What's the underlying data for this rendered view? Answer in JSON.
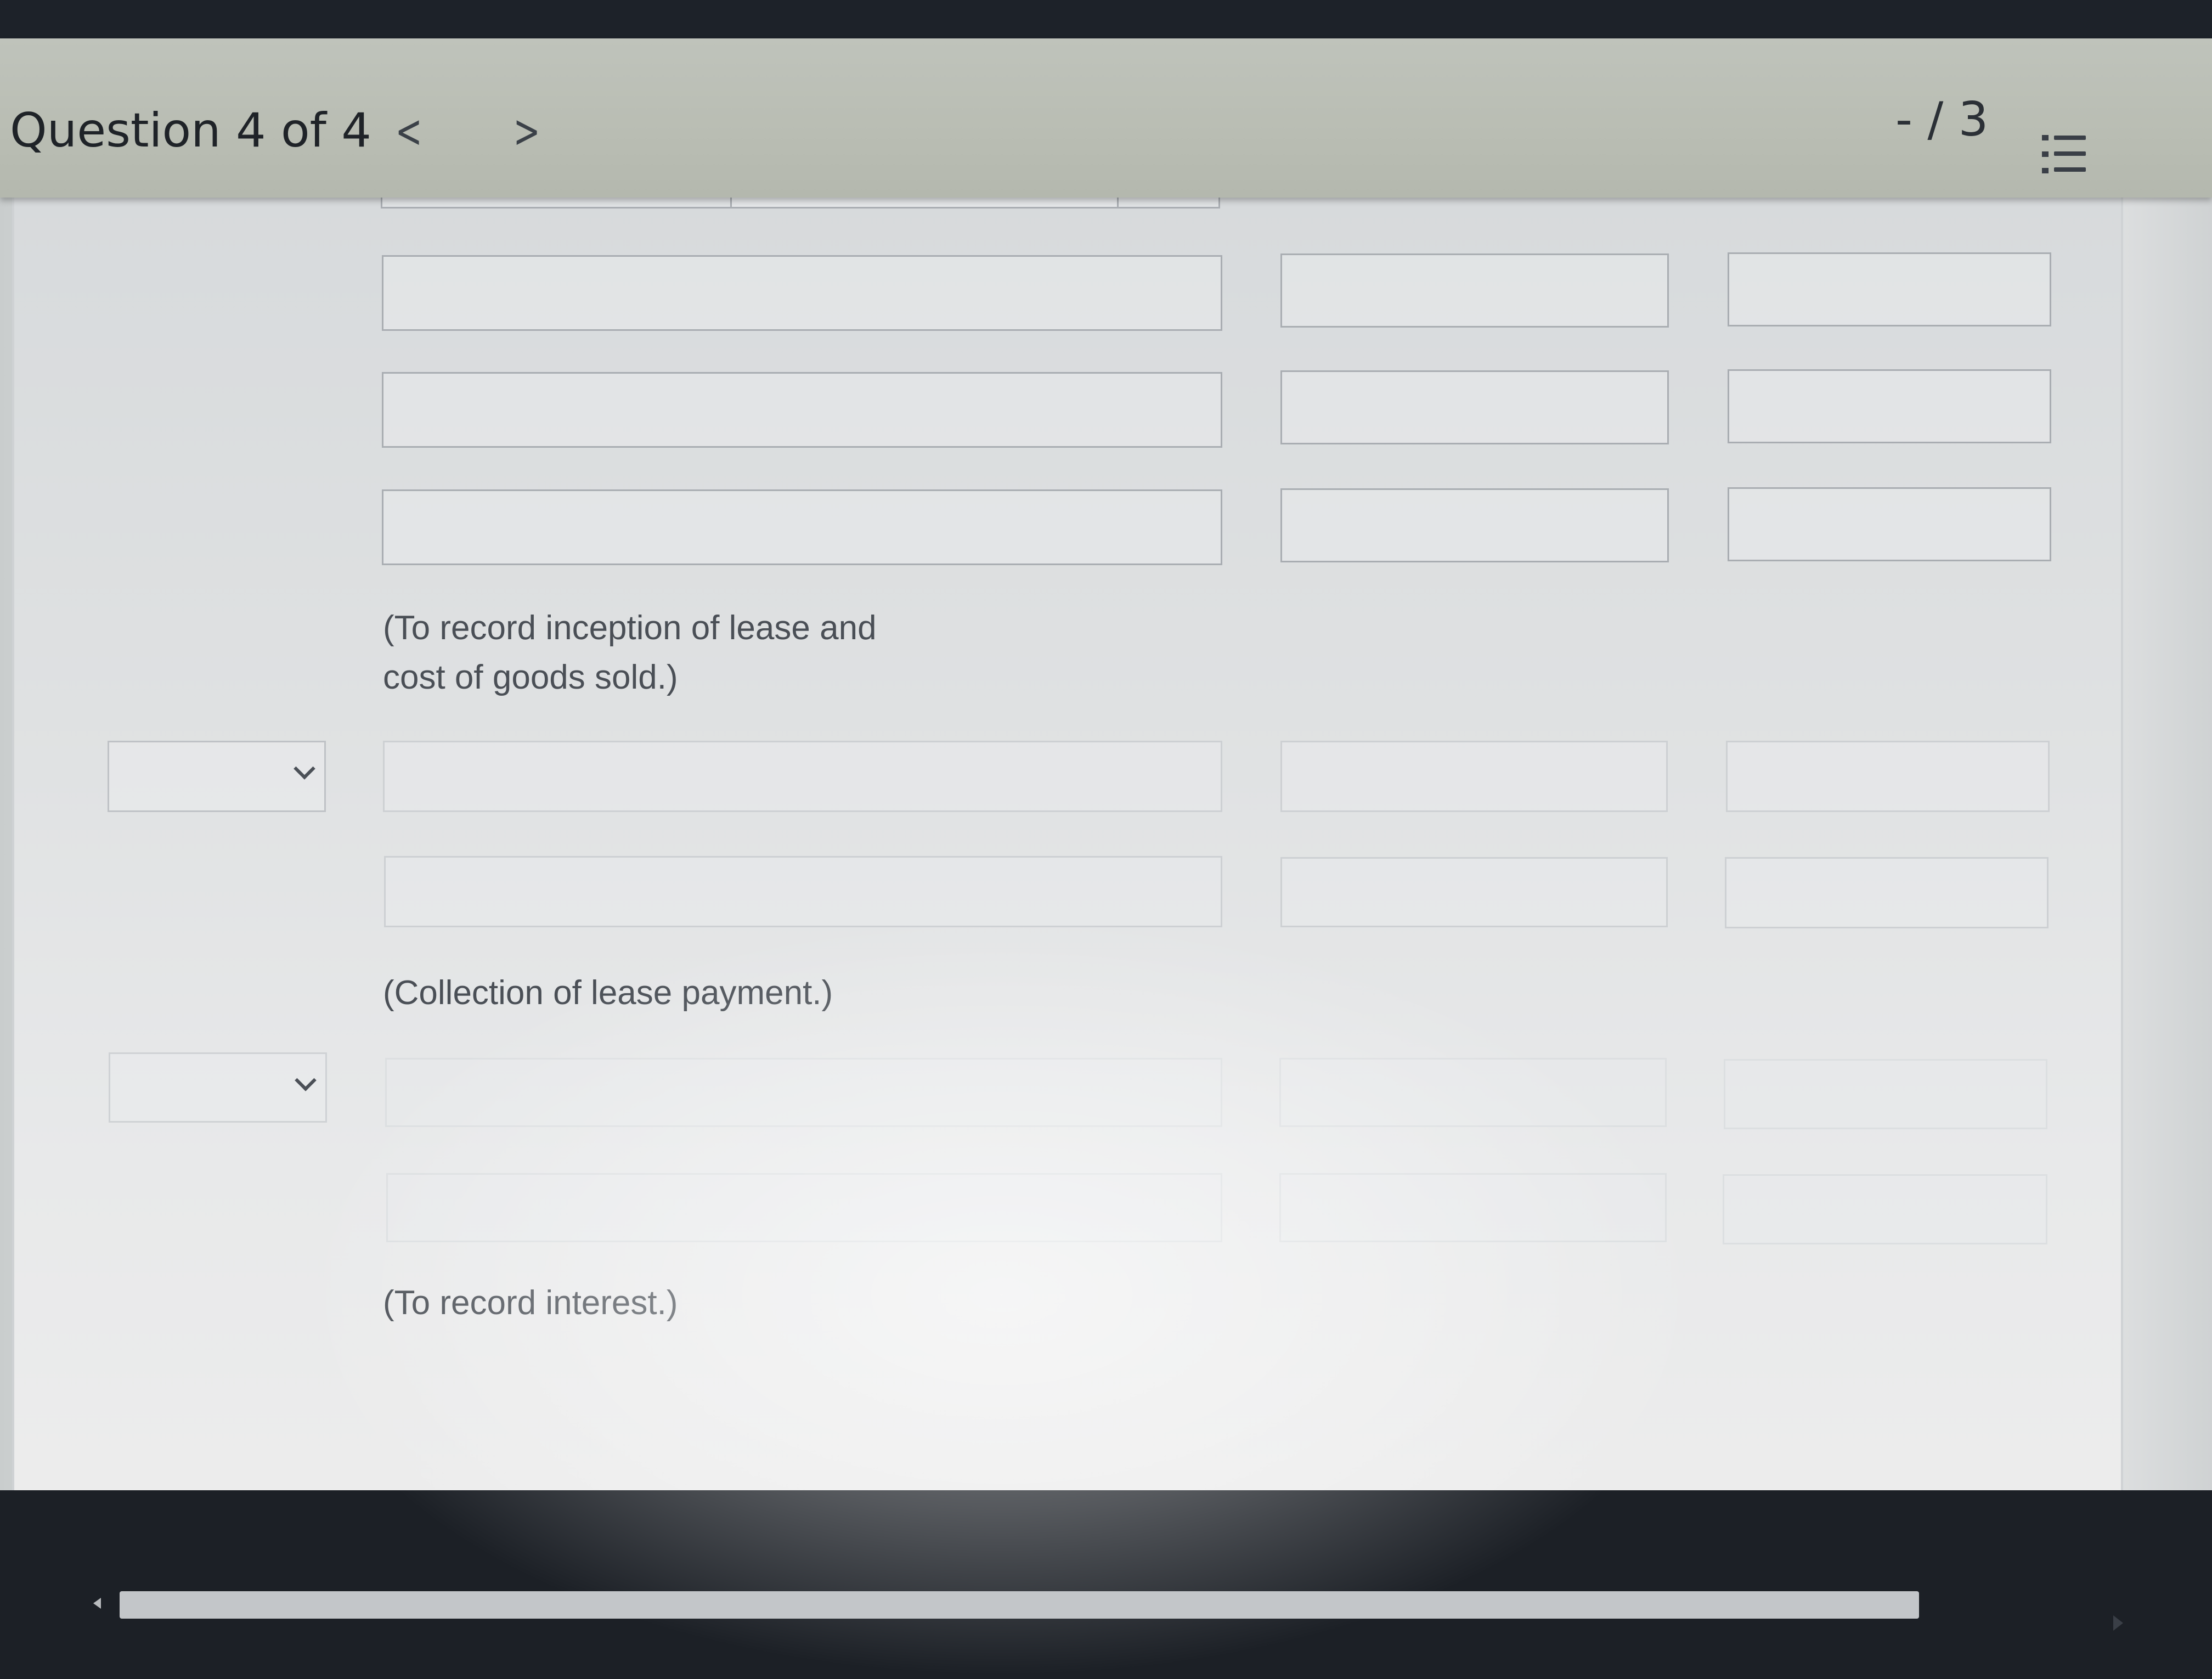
{
  "header": {
    "question_label": "Question 4 of 4",
    "prev_symbol": "<",
    "next_symbol": ">",
    "score": "- / 3",
    "menu_icon": "numbered-list-icon"
  },
  "captions": {
    "inception": "(To record inception of lease and cost of goods sold.)",
    "collection": "(Collection of lease payment.)",
    "interest": "(To record interest.)"
  },
  "entries": {
    "account_fields": [
      "",
      "",
      "",
      "",
      "",
      "",
      "",
      "",
      ""
    ],
    "debit_fields": [
      "",
      "",
      "",
      "",
      "",
      "",
      "",
      "",
      ""
    ],
    "credit_fields": [
      "",
      "",
      "",
      "",
      "",
      "",
      "",
      "",
      ""
    ],
    "date_selects": [
      "",
      ""
    ]
  }
}
